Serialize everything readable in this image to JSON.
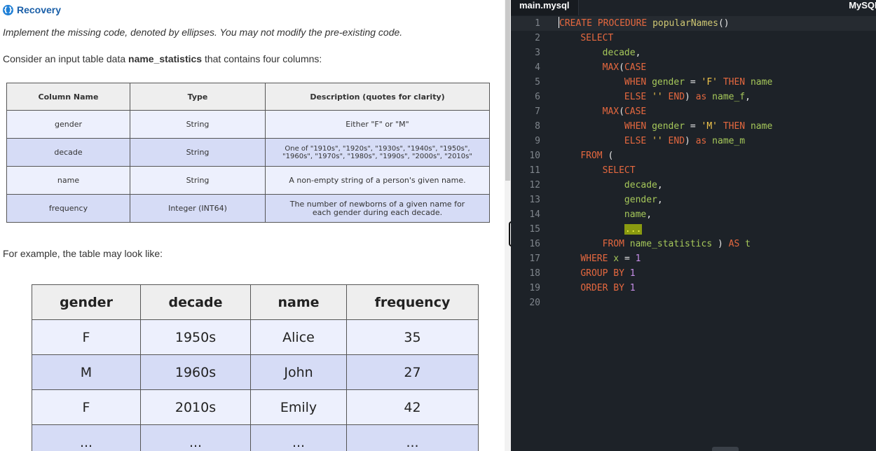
{
  "problem": {
    "icon": "{}",
    "title": "Recovery",
    "instruction": "Implement the missing code, denoted by ellipses. You may not modify the pre-existing code.",
    "consider_prefix": "Consider an input table data ",
    "consider_table": "name_statistics",
    "consider_suffix": " that contains four columns:",
    "example_text": "For example, the table may look like:"
  },
  "schema_table": {
    "headers": [
      "Column Name",
      "Type",
      "Description (quotes for clarity)"
    ],
    "rows": [
      [
        "gender",
        "String",
        "Either \"F\" or \"M\""
      ],
      [
        "decade",
        "String",
        "One of \"1910s\", \"1920s\", \"1930s\", \"1940s\", \"1950s\", \"1960s\", \"1970s\", \"1980s\", \"1990s\", \"2000s\", \"2010s\""
      ],
      [
        "name",
        "String",
        "A non-empty string of a person's given name."
      ],
      [
        "frequency",
        "Integer (INT64)",
        "The number of newborns of a given name for each gender during each decade."
      ]
    ]
  },
  "sample_table": {
    "headers": [
      "gender",
      "decade",
      "name",
      "frequency"
    ],
    "rows": [
      [
        "F",
        "1950s",
        "Alice",
        "35"
      ],
      [
        "M",
        "1960s",
        "John",
        "27"
      ],
      [
        "F",
        "2010s",
        "Emily",
        "42"
      ],
      [
        "...",
        "...",
        "...",
        "..."
      ]
    ]
  },
  "editor": {
    "file_name": "main.mysql",
    "language": "MySQL",
    "colors": {
      "background": "#1d2228",
      "keyword": "#e5683f",
      "identifier": "#a6c85a",
      "string": "#f2c64c",
      "number": "#c78ee8"
    },
    "line_numbers": [
      "1",
      "2",
      "3",
      "4",
      "5",
      "6",
      "7",
      "8",
      "9",
      "10",
      "11",
      "12",
      "13",
      "14",
      "15",
      "16",
      "17",
      "18",
      "19",
      "20"
    ]
  }
}
